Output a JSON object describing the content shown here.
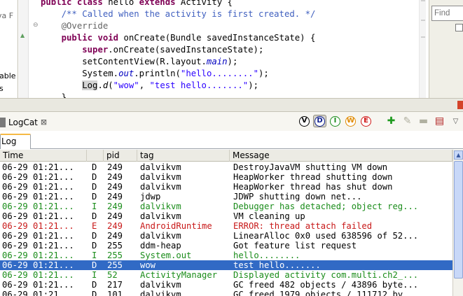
{
  "editor": {
    "left_strip": {
      "text_1": "va F",
      "text_2": "able",
      "text_3": "s"
    },
    "lines": [
      {
        "parts": [
          {
            "t": "public class",
            "c": "kw"
          },
          {
            "t": " hello ",
            "c": ""
          },
          {
            "t": "extends",
            "c": "kw"
          },
          {
            "t": " Activity {",
            "c": ""
          }
        ]
      },
      {
        "parts": [
          {
            "t": "    /** Called when the activity is first created. */",
            "c": "cmt"
          }
        ]
      },
      {
        "parts": [
          {
            "t": "    @Override",
            "c": "ann"
          }
        ]
      },
      {
        "parts": [
          {
            "t": "    ",
            "c": ""
          },
          {
            "t": "public void",
            "c": "kw"
          },
          {
            "t": " onCreate(Bundle savedInstanceState) {",
            "c": ""
          }
        ]
      },
      {
        "parts": [
          {
            "t": "        ",
            "c": ""
          },
          {
            "t": "super",
            "c": "kw"
          },
          {
            "t": ".onCreate(savedInstanceState);",
            "c": ""
          }
        ]
      },
      {
        "parts": [
          {
            "t": "        setContentView(R.layout.",
            "c": ""
          },
          {
            "t": "main",
            "c": "mn"
          },
          {
            "t": ");",
            "c": ""
          }
        ]
      },
      {
        "parts": [
          {
            "t": "        System.",
            "c": ""
          },
          {
            "t": "out",
            "c": "mn"
          },
          {
            "t": ".println(",
            "c": ""
          },
          {
            "t": "\"hello........\"",
            "c": "str"
          },
          {
            "t": ");",
            "c": ""
          }
        ]
      },
      {
        "parts": [
          {
            "t": "        ",
            "c": ""
          },
          {
            "t": "Log",
            "c": "hl"
          },
          {
            "t": ".",
            "c": ""
          },
          {
            "t": "d",
            "c": "it"
          },
          {
            "t": "(",
            "c": ""
          },
          {
            "t": "\"wow\"",
            "c": "str"
          },
          {
            "t": ", ",
            "c": ""
          },
          {
            "t": "\"test hello.......\"",
            "c": "str"
          },
          {
            "t": ");",
            "c": ""
          }
        ]
      },
      {
        "parts": [
          {
            "t": "    }",
            "c": ""
          }
        ]
      }
    ],
    "find_placeholder": "Find"
  },
  "logcat": {
    "view_title": "LogCat",
    "close_glyph": "⊠",
    "subtab_label": "Log",
    "level_buttons": [
      {
        "letter": "V",
        "color": "#000000",
        "active": false
      },
      {
        "letter": "D",
        "color": "#0a1c8c",
        "active": true
      },
      {
        "letter": "I",
        "color": "#1a8c1a",
        "active": false
      },
      {
        "letter": "W",
        "color": "#e08a00",
        "active": false
      },
      {
        "letter": "E",
        "color": "#d01818",
        "active": false
      }
    ],
    "columns": [
      "Time",
      "",
      "pid",
      "tag",
      "Message"
    ],
    "rows": [
      {
        "time": "06-29 01:21...",
        "level": "D",
        "pid": "249",
        "tag": "dalvikvm",
        "message": "DestroyJavaVM shutting VM down",
        "color": "#000000",
        "selected": false
      },
      {
        "time": "06-29 01:21...",
        "level": "D",
        "pid": "249",
        "tag": "dalvikvm",
        "message": "HeapWorker thread shutting down",
        "color": "#000000",
        "selected": false
      },
      {
        "time": "06-29 01:21...",
        "level": "D",
        "pid": "249",
        "tag": "dalvikvm",
        "message": "HeapWorker thread has shut down",
        "color": "#000000",
        "selected": false
      },
      {
        "time": "06-29 01:21...",
        "level": "D",
        "pid": "249",
        "tag": "jdwp",
        "message": "JDWP shutting down net...",
        "color": "#000000",
        "selected": false
      },
      {
        "time": "06-29 01:21...",
        "level": "I",
        "pid": "249",
        "tag": "dalvikvm",
        "message": "Debugger has detached; object reg...",
        "color": "#1a8c1a",
        "selected": false
      },
      {
        "time": "06-29 01:21...",
        "level": "D",
        "pid": "249",
        "tag": "dalvikvm",
        "message": "VM cleaning up",
        "color": "#000000",
        "selected": false
      },
      {
        "time": "06-29 01:21...",
        "level": "E",
        "pid": "249",
        "tag": "AndroidRuntime",
        "message": "ERROR: thread attach failed",
        "color": "#c81818",
        "selected": false
      },
      {
        "time": "06-29 01:21...",
        "level": "D",
        "pid": "249",
        "tag": "dalvikvm",
        "message": "LinearAlloc 0x0 used 638596 of 52...",
        "color": "#000000",
        "selected": false
      },
      {
        "time": "06-29 01:21...",
        "level": "D",
        "pid": "255",
        "tag": "ddm-heap",
        "message": "Got feature list request",
        "color": "#000000",
        "selected": false
      },
      {
        "time": "06-29 01:21...",
        "level": "I",
        "pid": "255",
        "tag": "System.out",
        "message": "hello........",
        "color": "#1a8c1a",
        "selected": false
      },
      {
        "time": "06-29 01:21...",
        "level": "D",
        "pid": "255",
        "tag": "wow",
        "message": "test hello.......",
        "color": "#ffffff",
        "selected": true
      },
      {
        "time": "06-29 01:21...",
        "level": "I",
        "pid": "52",
        "tag": "ActivityManager",
        "message": "Displayed activity com.multi.ch2_...",
        "color": "#1a8c1a",
        "selected": false
      },
      {
        "time": "06-29 01:21...",
        "level": "D",
        "pid": "217",
        "tag": "dalvikvm",
        "message": "GC freed 482 objects / 43896 byte...",
        "color": "#000000",
        "selected": false
      },
      {
        "time": "06-29 01:21...",
        "level": "D",
        "pid": "101",
        "tag": "dalvikvm",
        "message": "GC freed 1979 objects / 111712 by...",
        "color": "#000000",
        "selected": false
      }
    ]
  },
  "icons": {
    "add": "plus-icon",
    "edit": "edit-filter-icon",
    "remove": "minus-icon",
    "clear": "clear-log-icon",
    "menu": "view-menu-icon"
  }
}
